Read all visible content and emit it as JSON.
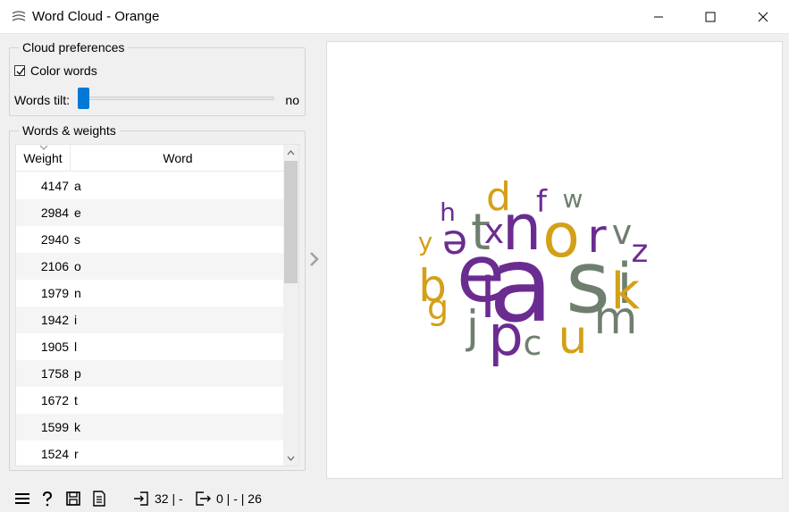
{
  "window": {
    "title": "Word Cloud - Orange"
  },
  "cloud_preferences": {
    "title": "Cloud preferences",
    "color_words_label": "Color words",
    "color_words_checked": true,
    "tilt_label": "Words tilt:",
    "tilt_value": "no",
    "tilt_level": 0
  },
  "words_weights": {
    "title": "Words & weights",
    "columns": [
      "Weight",
      "Word"
    ],
    "rows": [
      {
        "weight": "4147",
        "word": "a"
      },
      {
        "weight": "2984",
        "word": "e"
      },
      {
        "weight": "2940",
        "word": "s"
      },
      {
        "weight": "2106",
        "word": "o"
      },
      {
        "weight": "1979",
        "word": "n"
      },
      {
        "weight": "1942",
        "word": "i"
      },
      {
        "weight": "1905",
        "word": "l"
      },
      {
        "weight": "1758",
        "word": "p"
      },
      {
        "weight": "1672",
        "word": "t"
      },
      {
        "weight": "1599",
        "word": "k"
      },
      {
        "weight": "1524",
        "word": "r"
      }
    ]
  },
  "cloud": {
    "colors": {
      "purple": "#6b2c91",
      "gold": "#d4a017",
      "gray": "#6f7f6f"
    },
    "words": [
      {
        "text": "a",
        "color": "#6b2c91"
      },
      {
        "text": "e",
        "color": "#6b2c91"
      },
      {
        "text": "s",
        "color": "#6f7f6f"
      },
      {
        "text": "o",
        "color": "#d4a017"
      },
      {
        "text": "n",
        "color": "#6b2c91"
      },
      {
        "text": "i",
        "color": "#6f7f6f"
      },
      {
        "text": "l",
        "color": "#6b2c91"
      },
      {
        "text": "p",
        "color": "#6b2c91"
      },
      {
        "text": "t",
        "color": "#6f7f6f"
      },
      {
        "text": "k",
        "color": "#d4a017"
      },
      {
        "text": "r",
        "color": "#6b2c91"
      },
      {
        "text": "u",
        "color": "#d4a017"
      },
      {
        "text": "m",
        "color": "#6f7f6f"
      },
      {
        "text": "b",
        "color": "#d4a017"
      },
      {
        "text": "j",
        "color": "#6f7f6f"
      },
      {
        "text": "d",
        "color": "#d4a017"
      },
      {
        "text": "v",
        "color": "#6f7f6f"
      },
      {
        "text": "ə",
        "color": "#6b2c91"
      },
      {
        "text": "x",
        "color": "#6b2c91"
      },
      {
        "text": "g",
        "color": "#d4a017"
      },
      {
        "text": "c",
        "color": "#6f7f6f"
      },
      {
        "text": "z",
        "color": "#6b2c91"
      },
      {
        "text": "f",
        "color": "#6b2c91"
      },
      {
        "text": "h",
        "color": "#6b2c91"
      },
      {
        "text": "y",
        "color": "#d4a017"
      },
      {
        "text": "w",
        "color": "#6f7f6f"
      }
    ]
  },
  "status": {
    "input_summary": "32 | -",
    "output_summary": "0 | - | 26",
    "icons": [
      "menu-icon",
      "help-icon",
      "save-icon",
      "report-icon",
      "input-icon",
      "output-icon"
    ]
  }
}
